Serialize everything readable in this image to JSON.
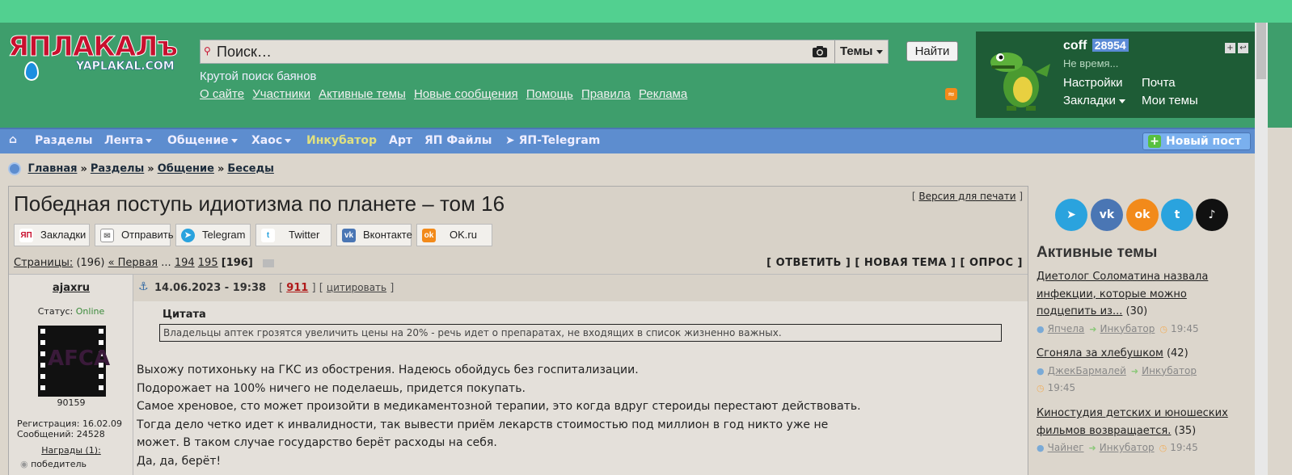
{
  "colors": {
    "top_stripe": "#52d090",
    "header_bg": "#3e9e6c",
    "nav_bg": "#5d8dcf",
    "user_panel_bg": "#1e5c36",
    "page_bg": "#dcd6cc",
    "incubator": "#e0e080"
  },
  "logo": {
    "main": "ЯПЛАКАЛъ",
    "sub": "YAPLAKAL.COM"
  },
  "search": {
    "placeholder": "Поиск…",
    "scope": "Темы",
    "button": "Найти",
    "tagline": "Крутой поиск баянов"
  },
  "top_links": [
    "О сайте",
    "Участники",
    "Активные темы",
    "Новые сообщения",
    "Помощь",
    "Правила",
    "Реклама"
  ],
  "user": {
    "name": "coff",
    "count": "28954",
    "status": "Не время...",
    "links": {
      "settings": "Настройки",
      "mail": "Почта",
      "bookmarks": "Закладки",
      "my_topics": "Мои темы"
    }
  },
  "nav": {
    "home_icon": "home-icon",
    "items": [
      "Разделы",
      "Лента",
      "Общение",
      "Хаос",
      "Инкубатор",
      "Арт",
      "ЯП Файлы",
      "ЯП-Telegram"
    ],
    "new_post": "Новый пост"
  },
  "breadcrumb": [
    "Главная",
    "Разделы",
    "Общение",
    "Беседы"
  ],
  "topic": {
    "title": "Победная поступь идиотизма по планете – том 16",
    "print_label": "Версия для печати",
    "share": [
      "Закладки",
      "Отправить",
      "Telegram",
      "Twitter",
      "Вконтакте",
      "OK.ru"
    ],
    "pages_label": "Страницы:",
    "pages_count": "(196)",
    "first": "« Первая",
    "ellipsis": "...",
    "pages": [
      "194",
      "195"
    ],
    "current_page": "[196]",
    "actions": "[ ОТВЕТИТЬ ] [ НОВАЯ ТЕМА ] [ ОПРОС ]"
  },
  "post": {
    "author": "ajaxru",
    "status_label": "Статус:",
    "status_value": "Online",
    "avatar_text": "AFCA",
    "user_id": "90159",
    "registration": "Регистрация: 16.02.09",
    "messages": "Сообщений: 24528",
    "awards": "Награды (1):",
    "award_first": "победитель",
    "date": "14.06.2023 - 19:38",
    "number": "911",
    "quote_link": "цитировать",
    "quote_title": "Цитата",
    "quote_text": "Владельцы аптек грозятся увеличить цены на 20% - речь идет о препаратах, не входящих в список жизненно важных.",
    "lines": [
      "Выхожу потихоньку на ГКС из обострения. Надеюсь обойдусь без госпитализации.",
      "Подорожает на 100% ничего не поделаешь, придется покупать.",
      "Самое хреновое, сто может произойти в медикаментозной терапии, это когда вдруг стероиды перестают действовать.",
      "Тогда дело четко идет к инвалидности, так вывести приём лекарств стоимостью под миллион в год никто уже не",
      "может. В таком случае государство берёт расходы на себя.",
      "Да, да, берёт!"
    ]
  },
  "sidebar": {
    "socials": [
      "telegram-icon",
      "vk-icon",
      "ok-icon",
      "twitter-icon",
      "tiktok-icon"
    ],
    "active_title": "Активные темы",
    "topics": [
      {
        "title_lines": [
          "Диетолог Соломатина назвала",
          "инфекции, которые можно",
          "подцепить из..."
        ],
        "count": "(30)",
        "user": "Япчела",
        "section": "Инкубатор",
        "time": "19:45"
      },
      {
        "title_lines": [
          "Сгоняла за хлебушком"
        ],
        "count": "(42)",
        "user": "ДжекБармалей",
        "section": "Инкубатор",
        "time": "19:45"
      },
      {
        "title_lines": [
          "Киностудия детских и юношеских",
          "фильмов возвращается."
        ],
        "count": "(35)",
        "user": "Чайнег",
        "section": "Инкубатор",
        "time": "19:45"
      }
    ]
  }
}
